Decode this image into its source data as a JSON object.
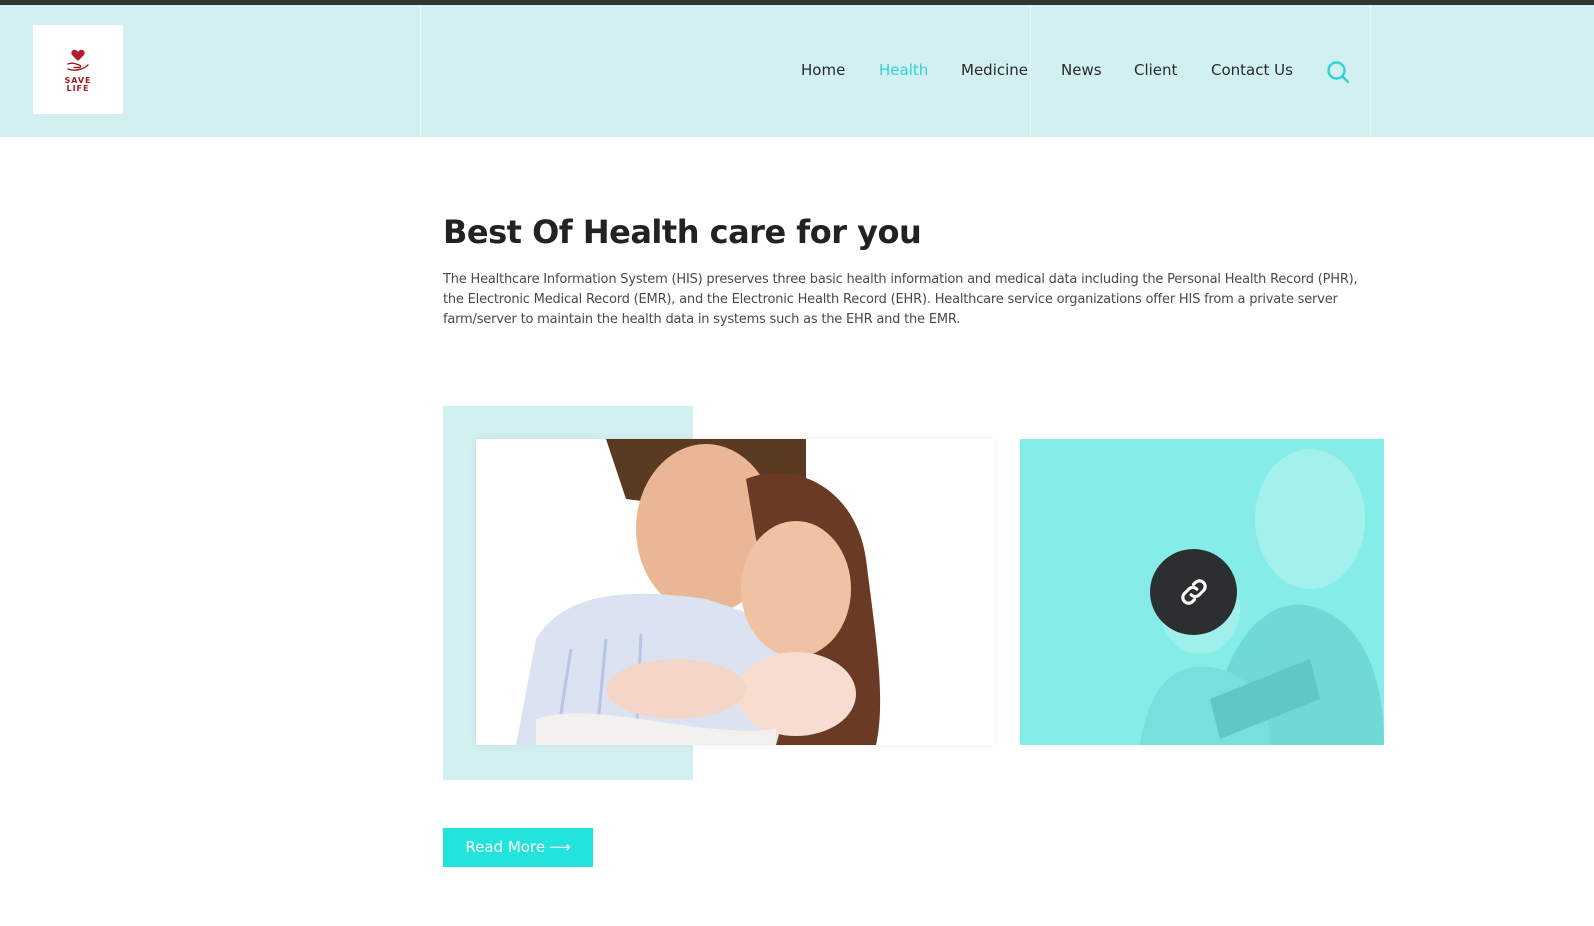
{
  "brand": {
    "logo_text_1": "SAVE",
    "logo_text_2": "LIFE",
    "logo_icon": "heart-hand-icon",
    "logo_color": "#9b1c1c"
  },
  "nav": {
    "items": [
      {
        "label": "Home",
        "active": false
      },
      {
        "label": "Health",
        "active": true
      },
      {
        "label": "Medicine",
        "active": false
      },
      {
        "label": "News",
        "active": false
      },
      {
        "label": "Client",
        "active": false
      },
      {
        "label": "Contact Us",
        "active": false
      }
    ],
    "search_icon": "search-icon",
    "active_color": "#2fd4d6"
  },
  "main": {
    "title": "Best Of Health care for you",
    "description": "The Healthcare Information System (HIS) preserves three basic health information and medical data including the Personal Health Record (PHR), the Electronic Medical Record (EMR), and the Electronic Health Record (EHR). Healthcare service organizations offer HIS from a private server farm/server to maintain the health data in systems such as the EHR and the EMR.",
    "read_more_label": "Read More",
    "read_more_arrow": "⟶",
    "link_icon": "link-icon"
  },
  "colors": {
    "header_bg": "#d2eff1",
    "accent": "#23e3dd",
    "overlay": "#86ece8",
    "dark": "#2b2f2f"
  }
}
